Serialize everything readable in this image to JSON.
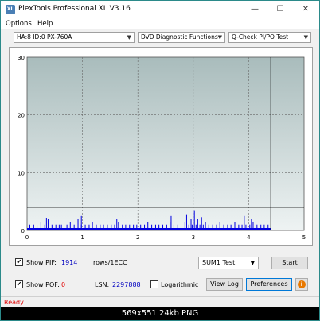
{
  "window": {
    "title": "PlexTools Professional XL V3.16",
    "icon_text": "XL",
    "controls": {
      "minimize": "—",
      "maximize": "☐",
      "close": "✕"
    }
  },
  "menu": {
    "options": "Options",
    "help": "Help"
  },
  "toolbar": {
    "drive": "HA:8 ID:0  PX-760A",
    "function": "DVD Diagnostic Functions",
    "test": "Q-Check PI/PO Test"
  },
  "chart_data": {
    "type": "bar",
    "x_range": [
      0,
      5
    ],
    "y_range": [
      0,
      30
    ],
    "x_ticks": [
      "0",
      "1",
      "2",
      "3",
      "4",
      "5"
    ],
    "y_ticks": [
      "0",
      "10",
      "20",
      "30"
    ],
    "threshold_line": 4,
    "end_marker_x": 4.4,
    "grid": true,
    "series_color": "#0000e0",
    "bars": [
      [
        0.05,
        1
      ],
      [
        0.12,
        1
      ],
      [
        0.18,
        1
      ],
      [
        0.25,
        1.5
      ],
      [
        0.32,
        1
      ],
      [
        0.38,
        2
      ],
      [
        0.45,
        1
      ],
      [
        0.52,
        1
      ],
      [
        0.58,
        1
      ],
      [
        0.62,
        1
      ],
      [
        0.72,
        1
      ],
      [
        0.78,
        1.5
      ],
      [
        0.85,
        1
      ],
      [
        0.92,
        2
      ],
      [
        0.98,
        1
      ],
      [
        1.05,
        1
      ],
      [
        1.12,
        1
      ],
      [
        1.18,
        1.5
      ],
      [
        1.25,
        1
      ],
      [
        1.32,
        1
      ],
      [
        1.38,
        1
      ],
      [
        1.45,
        1
      ],
      [
        1.52,
        1
      ],
      [
        1.58,
        1
      ],
      [
        1.65,
        1.5
      ],
      [
        1.72,
        1
      ],
      [
        1.78,
        1
      ],
      [
        1.85,
        1
      ],
      [
        1.92,
        1
      ],
      [
        1.98,
        1
      ],
      [
        2.05,
        1
      ],
      [
        2.12,
        1
      ],
      [
        2.18,
        1.5
      ],
      [
        2.25,
        1
      ],
      [
        2.32,
        1
      ],
      [
        2.38,
        1
      ],
      [
        2.45,
        1
      ],
      [
        2.52,
        1
      ],
      [
        2.58,
        1.5
      ],
      [
        2.65,
        1
      ],
      [
        2.72,
        1
      ],
      [
        2.78,
        1
      ],
      [
        2.85,
        1.5
      ],
      [
        2.92,
        1
      ],
      [
        2.98,
        1
      ],
      [
        3.05,
        1
      ],
      [
        3.08,
        2
      ],
      [
        3.12,
        1
      ],
      [
        3.18,
        1
      ],
      [
        3.22,
        1.5
      ],
      [
        3.28,
        1
      ],
      [
        3.35,
        1
      ],
      [
        3.42,
        1
      ],
      [
        3.48,
        1.5
      ],
      [
        3.55,
        1
      ],
      [
        3.62,
        1
      ],
      [
        3.68,
        1
      ],
      [
        3.75,
        1.5
      ],
      [
        3.82,
        1
      ],
      [
        3.88,
        1
      ],
      [
        3.95,
        1
      ],
      [
        4.02,
        1
      ],
      [
        4.08,
        1.5
      ],
      [
        4.15,
        1
      ],
      [
        4.22,
        1
      ],
      [
        4.28,
        1
      ],
      [
        4.35,
        1
      ],
      [
        0.35,
        2.2
      ],
      [
        0.98,
        2.5
      ],
      [
        1.62,
        2
      ],
      [
        2.6,
        2.5
      ],
      [
        2.88,
        2.8
      ],
      [
        2.96,
        2
      ],
      [
        3.15,
        2.3
      ],
      [
        3.92,
        2.5
      ],
      [
        4.05,
        2
      ],
      [
        3.02,
        3.5
      ]
    ]
  },
  "controls": {
    "show_pif_label": "Show PIF:",
    "pif_value": "1914",
    "pif_unit": "rows/1ECC",
    "show_pof_label": "Show POF:",
    "pof_value": "0",
    "lsn_label": "LSN:",
    "lsn_value": "2297888",
    "logarithmic_label": "Logarithmic",
    "sum_select": "SUM1 Test",
    "start_button": "Start",
    "view_log_button": "View Log",
    "preferences_button": "Preferences",
    "info_icon": "i",
    "show_pif_checked": "✔",
    "show_pof_checked": "✔"
  },
  "status": {
    "text": "Ready",
    "color": "#e00000"
  },
  "caption": "569x551  24kb  PNG"
}
